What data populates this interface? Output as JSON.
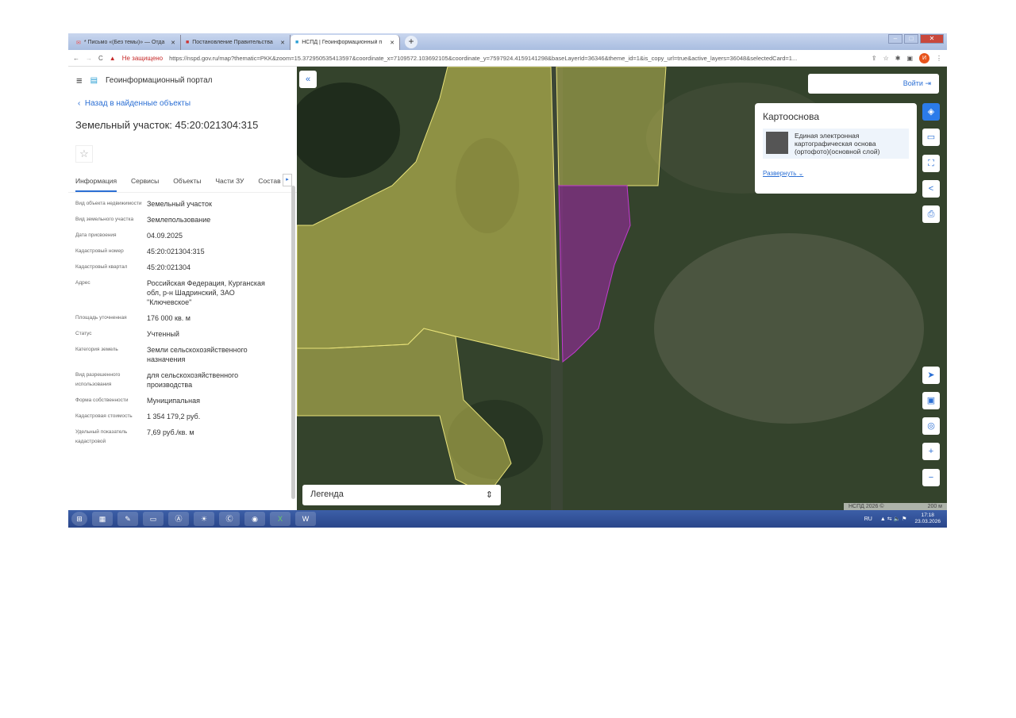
{
  "browser": {
    "tabs": [
      {
        "label": "* Письмо «(Без темы)» — Отда"
      },
      {
        "label": "Постановление Правительства"
      },
      {
        "label": "НСПД | Геоинформационный п"
      }
    ],
    "security": "Не защищено",
    "url": "https://nspd.gov.ru/map?thematic=PKK&zoom=15.372950535413597&coordinate_x=7109572.103692105&coordinate_y=7597924.4159141298&baseLayerId=36346&theme_id=1&is_copy_url=true&active_layers=36048&selectedCard=1...",
    "profile": "И"
  },
  "sidebar": {
    "portal": "Геоинформационный портал",
    "back": "Назад в найденные объекты",
    "title": "Земельный участок: 45:20:021304:315",
    "tabs": [
      "Информация",
      "Сервисы",
      "Объекты",
      "Части ЗУ",
      "Состав"
    ],
    "rows": [
      {
        "k": "Вид объекта недвижимости",
        "v": "Земельный участок"
      },
      {
        "k": "Вид земельного участка",
        "v": "Землепользование"
      },
      {
        "k": "Дата присвоения",
        "v": "04.09.2025"
      },
      {
        "k": "Кадастровый номер",
        "v": "45:20:021304:315"
      },
      {
        "k": "Кадастровый квартал",
        "v": "45:20:021304"
      },
      {
        "k": "Адрес",
        "v": "Российская Федерация, Курганская обл, р-н Шадринский, ЗАО \"Ключевское\""
      },
      {
        "k": "Площадь уточненная",
        "v": "176 000 кв. м"
      },
      {
        "k": "Статус",
        "v": "Учтенный"
      },
      {
        "k": "Категория земель",
        "v": "Земли сельскохозяйственного назначения"
      },
      {
        "k": "Вид разрешенного использования",
        "v": "для сельскохозяйственного производства"
      },
      {
        "k": "Форма собственности",
        "v": "Муниципальная"
      },
      {
        "k": "Кадастровая стоимость",
        "v": "1 354 179,2 руб."
      },
      {
        "k": "Удельный показатель кадастровой",
        "v": "7,69 руб./кв. м"
      }
    ]
  },
  "map": {
    "login": "Войти",
    "karto_title": "Картооснова",
    "karto_item": "Единая электронная картографическая основа (ортофото)(основной слой)",
    "expand": "Развернуть",
    "legend": "Легенда",
    "copyright": "НСПД 2026 ©",
    "scale": "200 м"
  },
  "taskbar": {
    "lang": "RU",
    "time": "17:18",
    "date": "23.03.2026"
  }
}
